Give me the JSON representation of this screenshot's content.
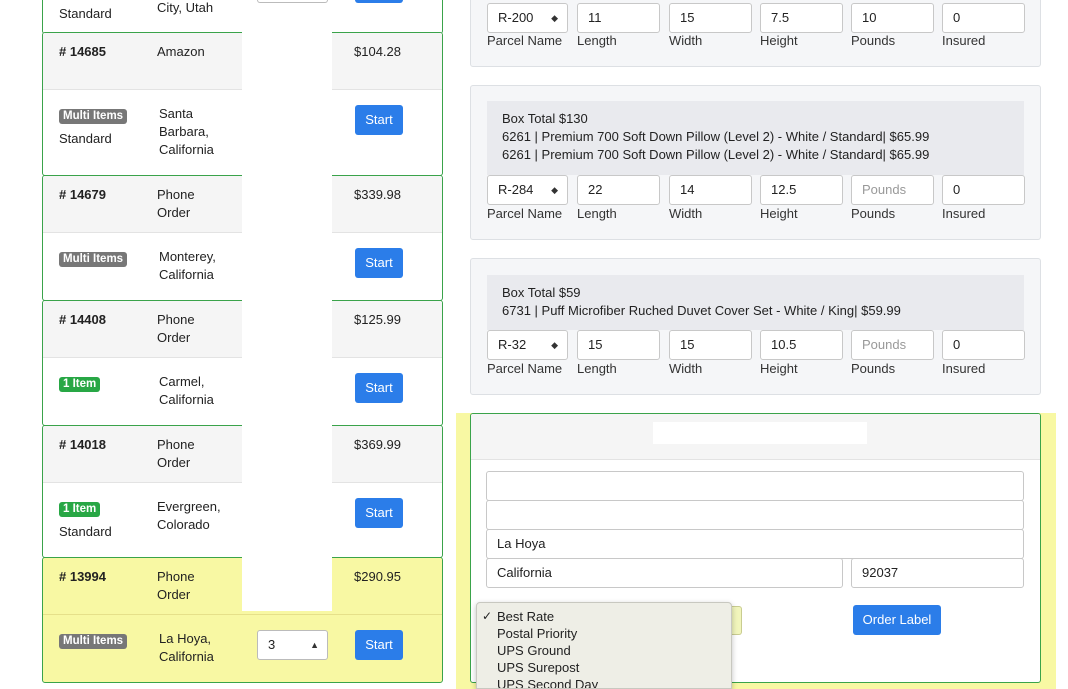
{
  "orders": [
    {
      "id": "partial-top",
      "number": "",
      "source": "",
      "amount": "",
      "badge": "",
      "badge_type": "",
      "shipping": "Standard",
      "city": "City, Utah",
      "start_label": ""
    },
    {
      "id": "14685",
      "number": "# 14685",
      "source": "Amazon",
      "amount": "$104.28",
      "badge": "Multi Items",
      "badge_type": "multi",
      "shipping": "Standard",
      "city": "Santa Barbara, California",
      "start_label": "Start"
    },
    {
      "id": "14679",
      "number": "# 14679",
      "source": "Phone Order",
      "amount": "$339.98",
      "badge": "Multi Items",
      "badge_type": "multi",
      "shipping": "",
      "city": "Monterey, California",
      "start_label": "Start"
    },
    {
      "id": "14408",
      "number": "# 14408",
      "source": "Phone Order",
      "amount": "$125.99",
      "badge": "1 Item",
      "badge_type": "one",
      "shipping": "",
      "city": "Carmel, California",
      "start_label": "Start"
    },
    {
      "id": "14018",
      "number": "# 14018",
      "source": "Phone Order",
      "amount": "$369.99",
      "badge": "1 Item",
      "badge_type": "one",
      "shipping": "Standard",
      "city": "Evergreen, Colorado",
      "start_label": "Start"
    },
    {
      "id": "13994",
      "number": "# 13994",
      "source": "Phone Order",
      "amount": "$290.95",
      "badge": "Multi Items",
      "badge_type": "multi",
      "shipping": "",
      "city": "La Hoya, California",
      "start_label": "Start",
      "quantity": "3"
    }
  ],
  "field_labels": {
    "parcel": "Parcel Name",
    "length": "Length",
    "width": "Width",
    "height": "Height",
    "pounds": "Pounds",
    "insured": "Insured"
  },
  "boxes": [
    {
      "total": "",
      "items": [],
      "parcel": "R-200",
      "length": "11",
      "width": "15",
      "height": "7.5",
      "pounds": "10",
      "pounds_placeholder": "Pounds",
      "insured": "0"
    },
    {
      "total": "Box Total $130",
      "items": [
        "6261 | Premium 700 Soft Down Pillow (Level 2) - White / Standard| $65.99",
        "6261 | Premium 700 Soft Down Pillow (Level 2) - White / Standard| $65.99"
      ],
      "parcel": "R-284",
      "length": "22",
      "width": "14",
      "height": "12.5",
      "pounds": "",
      "pounds_placeholder": "Pounds",
      "insured": "0"
    },
    {
      "total": "Box Total $59",
      "items": [
        "6731 | Puff Microfiber Ruched Duvet Cover Set - White / King| $59.99"
      ],
      "parcel": "R-32",
      "length": "15",
      "width": "15",
      "height": "10.5",
      "pounds": "",
      "pounds_placeholder": "Pounds",
      "insured": "0"
    }
  ],
  "shipping_form": {
    "address1": "",
    "address2": "",
    "city": "La Hoya",
    "state": "California",
    "zip": "92037",
    "order_label_button": "Order Label",
    "rate_options": [
      "Best Rate",
      "Postal Priority",
      "UPS Ground",
      "UPS Surepost",
      "UPS Second Day"
    ],
    "selected_rate": "Best Rate",
    "check_glyph": "✓"
  },
  "colors": {
    "primary_button": "#2b7de9",
    "card_border": "#3aa34a",
    "highlight": "#f8f8a3",
    "badge_multi": "#777777",
    "badge_one": "#28a745"
  }
}
